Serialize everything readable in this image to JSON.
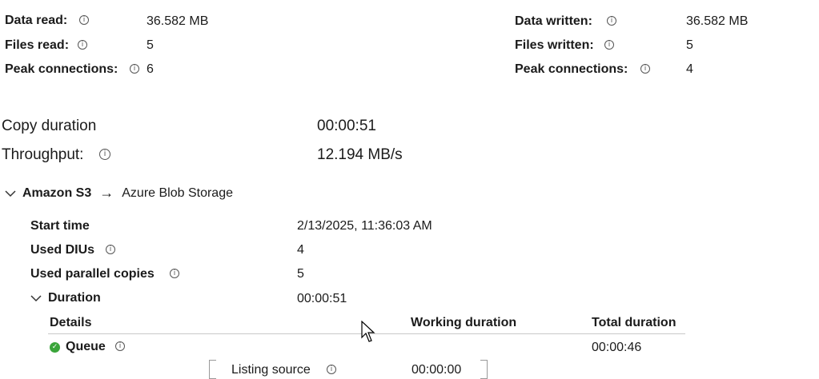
{
  "source_stats": {
    "data_read_label": "Data read:",
    "data_read_value": "36.582 MB",
    "files_read_label": "Files read:",
    "files_read_value": "5",
    "peak_label": "Peak connections:",
    "peak_value": "6"
  },
  "sink_stats": {
    "data_written_label": "Data written:",
    "data_written_value": "36.582 MB",
    "files_written_label": "Files written:",
    "files_written_value": "5",
    "peak_label": "Peak connections:",
    "peak_value": "4"
  },
  "summary": {
    "copy_duration_label": "Copy duration",
    "copy_duration_value": "00:00:51",
    "throughput_label": "Throughput:",
    "throughput_value": "12.194 MB/s"
  },
  "route": {
    "source": "Amazon S3",
    "arrow": "→",
    "destination": "Azure Blob Storage"
  },
  "details": {
    "start_time_label": "Start time",
    "start_time_value": "2/13/2025, 11:36:03 AM",
    "dius_label": "Used DIUs",
    "dius_value": "4",
    "parallel_label": "Used parallel copies",
    "parallel_value": "5",
    "duration_label": "Duration",
    "duration_value": "00:00:51"
  },
  "duration_table": {
    "headers": [
      "Details",
      "Working duration",
      "Total duration"
    ],
    "queue_label": "Queue",
    "queue_total": "00:00:46",
    "listing_label": "Listing source",
    "listing_working": "00:00:00"
  },
  "icons": {
    "info": "info-icon",
    "chevron": "chevron-down-icon",
    "check": "check-circle-icon",
    "cursor": "mouse-pointer-icon"
  },
  "colors": {
    "success": "#3aa53a",
    "divider": "#c8c8c8"
  }
}
